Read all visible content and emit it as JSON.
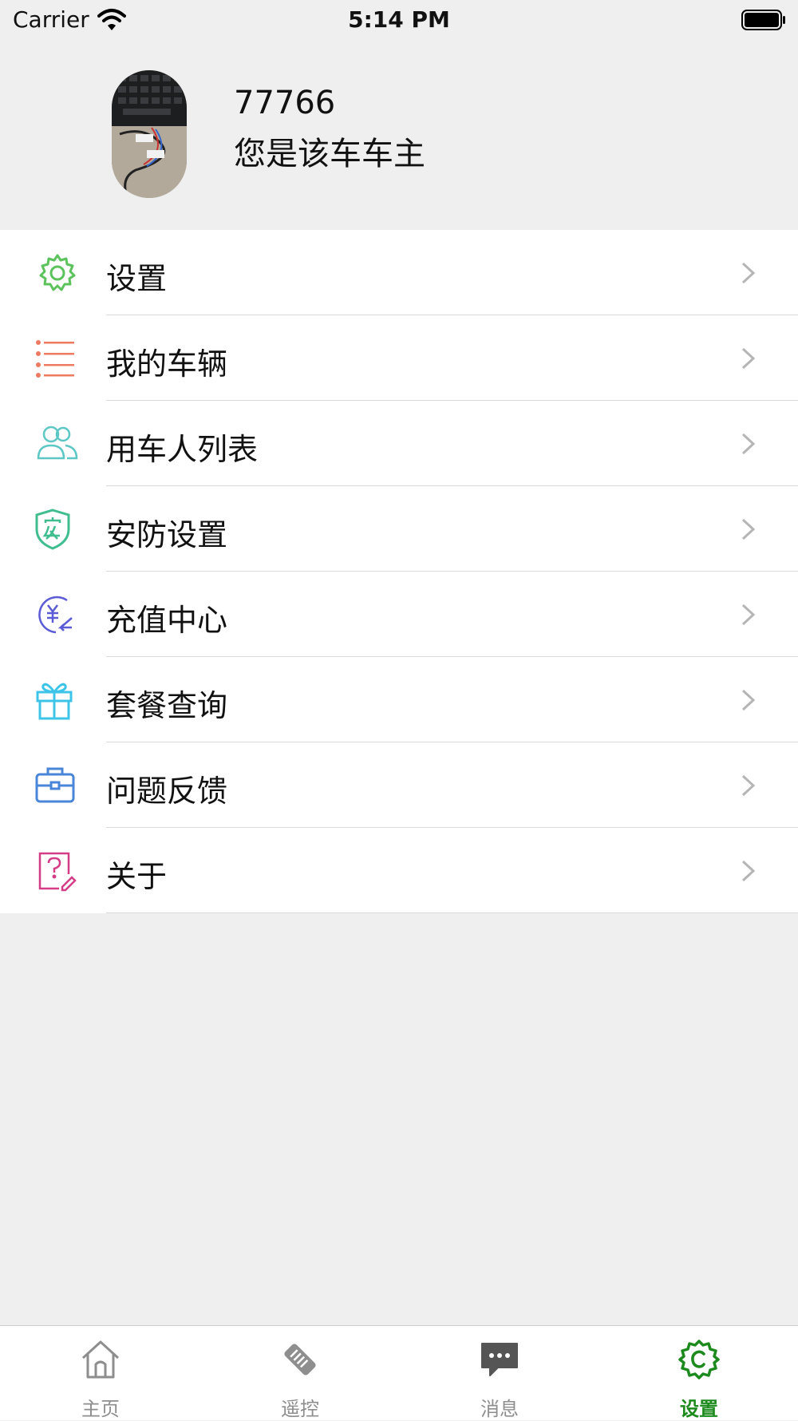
{
  "status_bar": {
    "carrier": "Carrier",
    "time": "5:14 PM"
  },
  "profile": {
    "user_id": "77766",
    "role": "您是该车车主"
  },
  "menu": {
    "items": [
      {
        "label": "设置",
        "icon": "gear-icon",
        "color": "#5cc35c"
      },
      {
        "label": "我的车辆",
        "icon": "list-icon",
        "color": "#ef7a62"
      },
      {
        "label": "用车人列表",
        "icon": "users-icon",
        "color": "#5cc7c5"
      },
      {
        "label": "安防设置",
        "icon": "shield-icon",
        "color": "#3fbd8f"
      },
      {
        "label": "充值中心",
        "icon": "recharge-icon",
        "color": "#5b5bd6"
      },
      {
        "label": "套餐查询",
        "icon": "gift-icon",
        "color": "#3cc4e9"
      },
      {
        "label": "问题反馈",
        "icon": "briefcase-icon",
        "color": "#4a86d8"
      },
      {
        "label": "关于",
        "icon": "help-doc-icon",
        "color": "#d43d86"
      }
    ]
  },
  "tab_bar": {
    "tabs": [
      {
        "label": "主页",
        "icon": "home-icon",
        "active": false
      },
      {
        "label": "遥控",
        "icon": "remote-key-icon",
        "active": false
      },
      {
        "label": "消息",
        "icon": "message-icon",
        "active": false
      },
      {
        "label": "设置",
        "icon": "settings-badge-icon",
        "active": true
      }
    ],
    "active_color": "#1d8a1d",
    "inactive_color": "#8e8e8e"
  }
}
